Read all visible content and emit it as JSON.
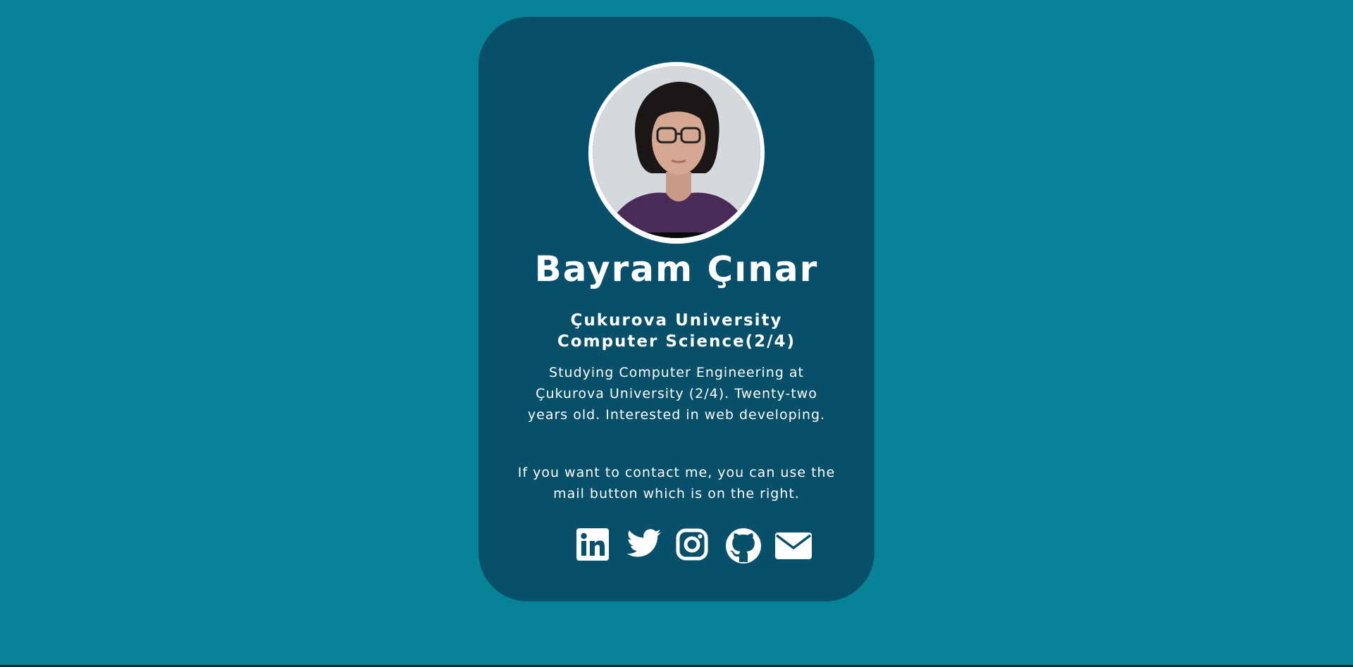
{
  "profile": {
    "name": "Bayram Çınar",
    "university_line1": "Çukurova University",
    "university_line2": "Computer Science(2/4)",
    "bio": "Studying Computer Engineering at Çukurova University (2/4). Twenty-two years old. Interested in web developing.",
    "contact_note": "If you want to contact me, you can use the mail button which is on the right."
  },
  "socials": [
    {
      "icon": "linkedin-icon"
    },
    {
      "icon": "twitter-icon"
    },
    {
      "icon": "instagram-icon"
    },
    {
      "icon": "github-icon"
    },
    {
      "icon": "mail-icon"
    }
  ],
  "colors": {
    "background": "#078296",
    "card": "#084f6a",
    "text": "#ffffff"
  }
}
